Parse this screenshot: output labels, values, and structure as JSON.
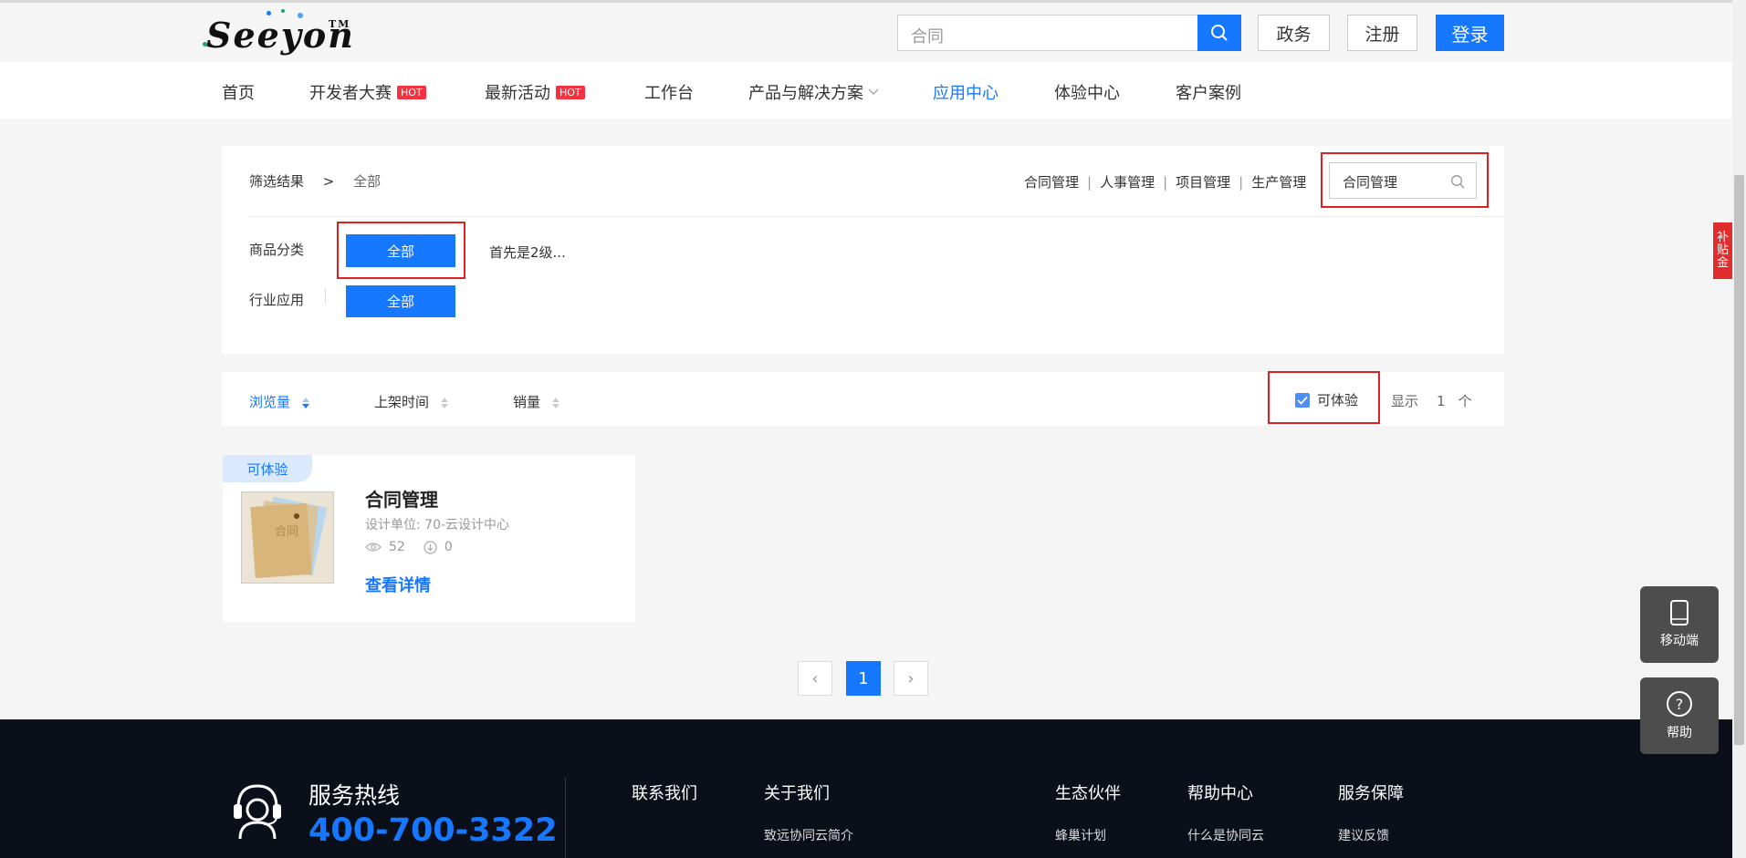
{
  "header": {
    "logo_text": "Seeyon",
    "logo_tm": "TM",
    "search_value": "合同",
    "gov_btn": "政务",
    "register_btn": "注册",
    "login_btn": "登录"
  },
  "nav": {
    "items": [
      "首页",
      "开发者大赛",
      "最新活动",
      "工作台",
      "产品与解决方案",
      "应用中心",
      "体验中心",
      "客户案例"
    ],
    "hot": "HOT",
    "active": "应用中心"
  },
  "filter": {
    "crumb_label": "筛选结果",
    "crumb_sep": ">",
    "crumb_value": "全部",
    "quick_tags": [
      "合同管理",
      "人事管理",
      "项目管理",
      "生产管理"
    ],
    "search_value": "合同管理",
    "category_label": "商品分类",
    "category_all": "全部",
    "category_hint": "首先是2级...",
    "industry_label": "行业应用",
    "industry_all": "全部"
  },
  "sort": {
    "views": "浏览量",
    "listing_time": "上架时间",
    "sales": "销量",
    "trial_checkbox": "可体验",
    "trial_checked": true,
    "show_label": "显示",
    "show_count": "1",
    "show_unit": "个"
  },
  "card": {
    "badge": "可体验",
    "thumb_text": "合同",
    "title": "合同管理",
    "designer": "设计单位: 70-云设计中心",
    "views": "52",
    "downloads": "0",
    "detail_link": "查看详情"
  },
  "pager": {
    "prev": "‹",
    "current": "1",
    "next": "›"
  },
  "footer": {
    "hotline_label": "服务热线",
    "hotline_number": "400-700-3322",
    "col1_title": "联系我们",
    "col2_title": "关于我们",
    "col2_item": "致远协同云简介",
    "col3_title": "生态伙伴",
    "col3_item": "蜂巢计划",
    "col4_title": "帮助中心",
    "col4_item": "什么是协同云",
    "col5_title": "服务保障",
    "col5_item": "建议反馈"
  },
  "side": {
    "mobile": "移动端",
    "help": "帮助",
    "subsidy": "补贴金"
  },
  "colors": {
    "primary": "#1677ff",
    "hot": "#f5323f",
    "highlight_box": "#e02020",
    "footer_bg": "#0b0f19"
  }
}
